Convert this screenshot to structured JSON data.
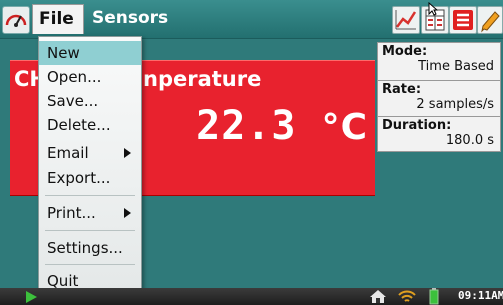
{
  "menubar": {
    "file_label": "File",
    "sensors_label": "Sensors"
  },
  "toolbar": {
    "icons": [
      "graph-icon",
      "table-icon",
      "list-icon",
      "pencil-icon"
    ],
    "colors": {
      "graph": "#d8322e",
      "table": "#cc3333",
      "list": "#e02020",
      "pencil": "#f0a020"
    }
  },
  "file_menu": {
    "items": [
      {
        "label": "New",
        "selected": true
      },
      {
        "label": "Open..."
      },
      {
        "label": "Save..."
      },
      {
        "label": "Delete..."
      },
      {
        "label": "Email",
        "submenu": true
      },
      {
        "label": "Export..."
      },
      {
        "label": "Print...",
        "submenu": true
      },
      {
        "label": "Settings..."
      },
      {
        "label": "Quit"
      }
    ]
  },
  "sensor": {
    "name_left": "CH",
    "name_right": "nperature",
    "value": "22.3",
    "unit": "°C",
    "panel_color": "#e8222e"
  },
  "collection": {
    "mode_label": "Mode:",
    "mode_value": "Time Based",
    "rate_label": "Rate:",
    "rate_value": "2 samples/s",
    "duration_label": "Duration:",
    "duration_value": "180.0 s"
  },
  "statusbar": {
    "clock": "09:11AM"
  },
  "colors": {
    "background": "#2f7a7a",
    "menu_highlight": "#8fcfd2"
  }
}
